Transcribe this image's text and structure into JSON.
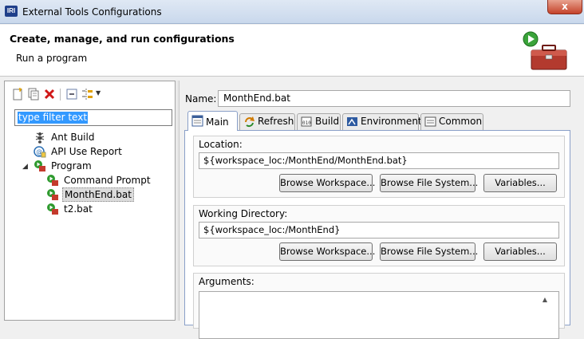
{
  "window": {
    "title": "External Tools Configurations",
    "app_icon_text": "IRI",
    "close_glyph": "x"
  },
  "banner": {
    "title": "Create, manage, and run configurations",
    "subtitle": "Run a program",
    "icon": "toolbox-run-icon"
  },
  "left_pane": {
    "toolbar_icons": [
      "new-configuration-icon",
      "duplicate-icon",
      "delete-icon",
      "collapse-all-icon",
      "filter-icon",
      "dropdown-arrow-icon"
    ],
    "filter": {
      "value": "type filter text"
    },
    "tree": [
      {
        "label": "Ant Build",
        "icon": "ant-icon",
        "level": 0
      },
      {
        "label": "API Use Report",
        "icon": "api-report-icon",
        "level": 0
      },
      {
        "label": "Program",
        "icon": "program-icon",
        "level": 0,
        "expanded": true
      },
      {
        "label": "Command Prompt",
        "icon": "program-config-icon",
        "level": 1
      },
      {
        "label": "MonthEnd.bat",
        "icon": "program-config-icon",
        "level": 1,
        "selected": true
      },
      {
        "label": "t2.bat",
        "icon": "program-config-icon",
        "level": 1
      }
    ]
  },
  "config": {
    "name_label": "Name:",
    "name_value": "MonthEnd.bat",
    "tabs": [
      {
        "label": "Main",
        "icon": "main-tab-icon",
        "active": true
      },
      {
        "label": "Refresh",
        "icon": "refresh-icon"
      },
      {
        "label": "Build",
        "icon": "build-icon"
      },
      {
        "label": "Environment",
        "icon": "environment-icon"
      },
      {
        "label": "Common",
        "icon": "common-icon"
      }
    ],
    "location": {
      "label": "Location:",
      "value": "${workspace_loc:/MonthEnd/MonthEnd.bat}",
      "buttons": [
        "Browse Workspace...",
        "Browse File System...",
        "Variables..."
      ]
    },
    "working_directory": {
      "label": "Working Directory:",
      "value": "${workspace_loc:/MonthEnd}",
      "buttons": [
        "Browse Workspace...",
        "Browse File System...",
        "Variables..."
      ]
    },
    "arguments": {
      "label": "Arguments:",
      "value": ""
    }
  },
  "colors": {
    "selection": "#3399ff",
    "close_button": "#c4432a",
    "tab_border": "#8aa0c8"
  }
}
